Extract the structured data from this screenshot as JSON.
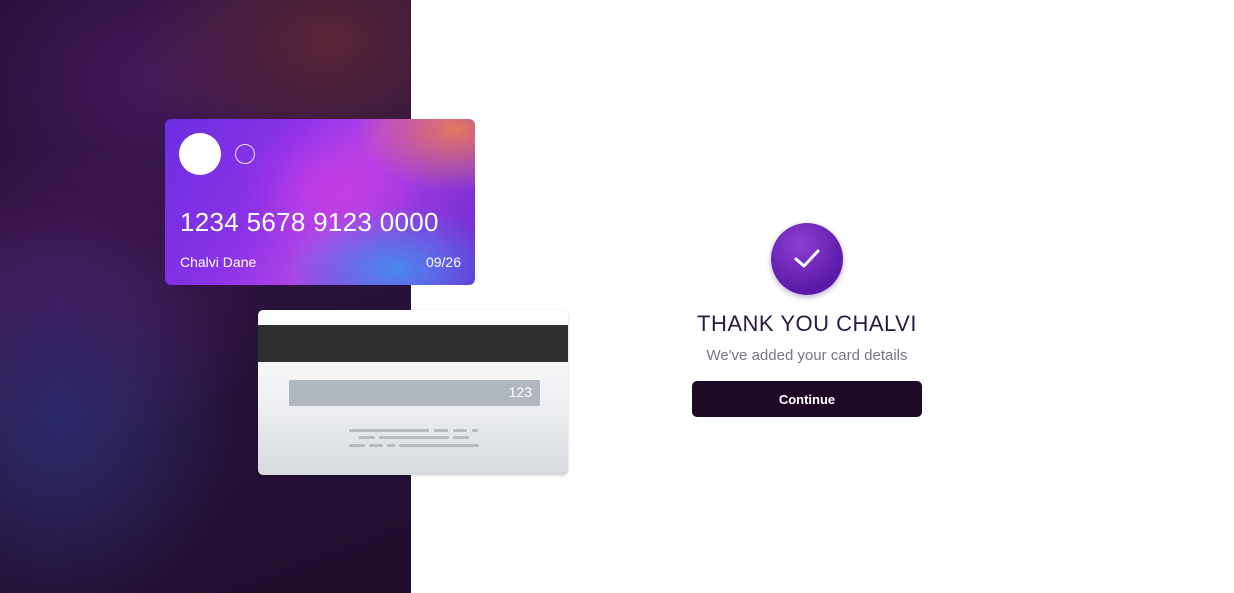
{
  "card_front": {
    "number": "1234 5678 9123 0000",
    "holder_name": "Chalvi Dane",
    "expiry": "09/26"
  },
  "card_back": {
    "cvv": "123"
  },
  "confirmation": {
    "icon": "checkmark-icon",
    "title": "THANK YOU CHALVI",
    "subtitle": "We've added your card details",
    "continue_label": "Continue"
  },
  "colors": {
    "accent": "#6d2ee0",
    "button": "#1f0a26",
    "success_icon": "#7a2fc8"
  }
}
